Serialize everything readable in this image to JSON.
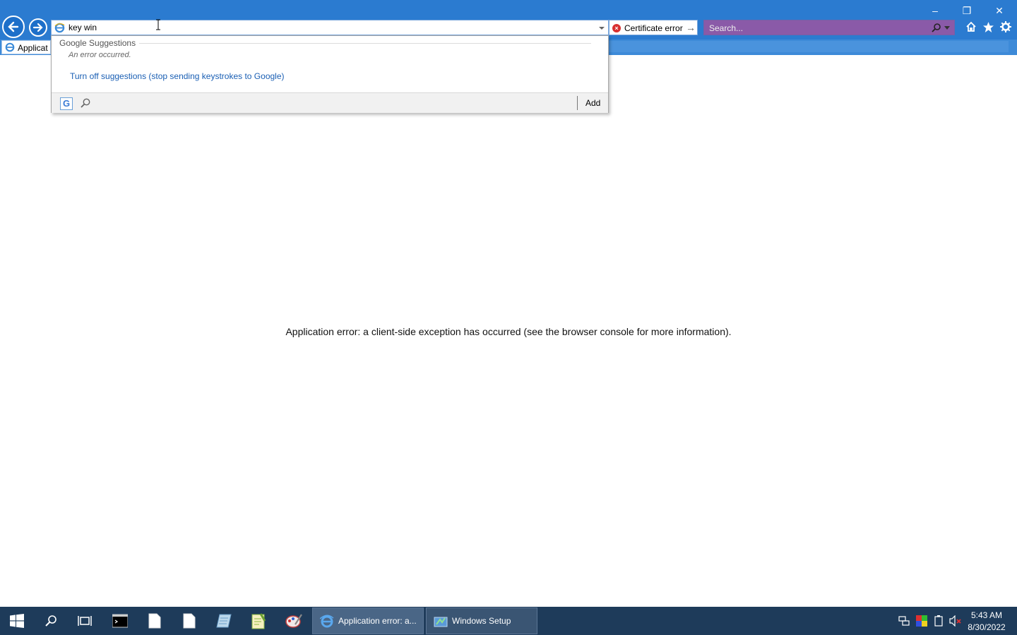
{
  "browser": {
    "address_value": "key win",
    "cert_label": "Certificate error",
    "search_placeholder": "Search...",
    "tab_label": "Applicat",
    "window_controls": [
      "minimize-icon",
      "restore-icon",
      "close-icon"
    ]
  },
  "suggestions": {
    "header": "Google Suggestions",
    "error": "An error occurred.",
    "turn_off": "Turn off suggestions (stop sending keystrokes to Google)",
    "add_label": "Add"
  },
  "page": {
    "message": "Application error: a client-side exception has occurred (see the browser console for more information)."
  },
  "taskbar": {
    "pinned": [
      "start-icon",
      "search-icon",
      "task-view-icon",
      "terminal-icon",
      "file-icon",
      "file-icon",
      "notepad-icon",
      "notepad-plus-icon",
      "paint-icon"
    ],
    "tasks": [
      {
        "label": "Application error: a...",
        "icon": "ie-icon",
        "active": true
      },
      {
        "label": "Windows Setup",
        "icon": "setup-icon",
        "active": false
      }
    ],
    "clock_time": "5:43 AM",
    "clock_date": "8/30/2022"
  },
  "colors": {
    "chrome": "#2b7bd0",
    "link": "#1a5fb4",
    "taskbar": "#1e3b5a",
    "search_box": "#8a5aa8"
  }
}
